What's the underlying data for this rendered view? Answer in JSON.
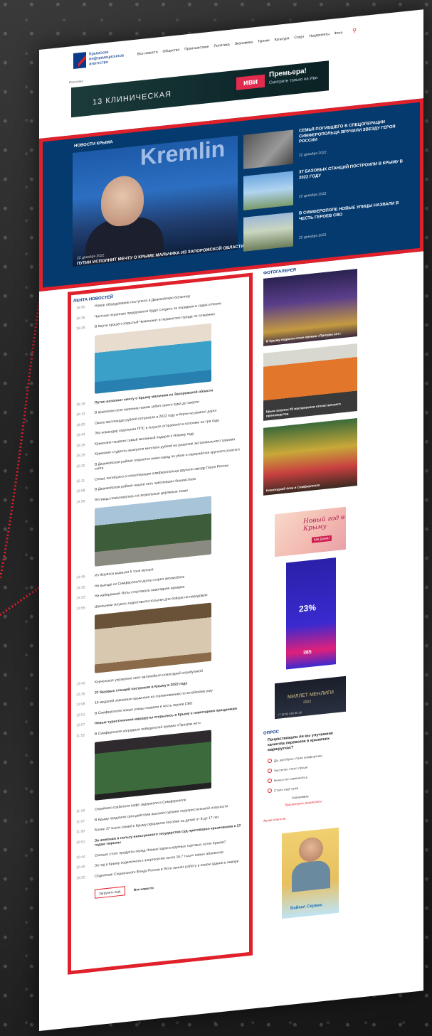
{
  "header": {
    "logo_text": "Крымское информационное агентство",
    "nav": [
      "Все новости",
      "Общество",
      "Происшествия",
      "Политика",
      "Экономика",
      "Туризм",
      "Культура",
      "Спорт",
      "Нацпроекты",
      "Фото"
    ]
  },
  "banner_top": {
    "label": "Реклама",
    "show": "13 КЛИНИЧЕСКАЯ",
    "brand": "иви",
    "title": "Премьера!",
    "subtitle": "Смотрите только на Иви"
  },
  "hero": {
    "section": "НОВОСТИ КРЫМА",
    "backdrop": "Kremlin",
    "date": "22 декабря 2022",
    "caption": "ПУТИН ИСПОЛНИТ МЕЧТУ О КРЫМЕ МАЛЬЧИКА ИЗ ЗАПОРОЖСКОЙ ОБЛАСТИ",
    "side": [
      {
        "title": "СЕМЬЯ ПОГИБШЕГО В СПЕЦОПЕРАЦИИ СИМФЕРОПОЛЬЦА ВРУЧИЛИ ЗВЕЗДУ ГЕРОЯ РОССИИ",
        "date": "22 декабря 2022"
      },
      {
        "title": "37 БАЗОВЫХ СТАНЦИЙ ПОСТРОИЛИ В КРЫМУ В 2022 ГОДУ",
        "date": "22 декабря 2022"
      },
      {
        "title": "В СИМФЕРОПОЛЕ НОВЫЕ УЛИЦЫ НАЗВАЛИ В ЧЕСТЬ ГЕРОЕВ СВО",
        "date": "22 декабря 2022"
      }
    ]
  },
  "feed": {
    "title": "ЛЕНТА НОВОСТЕЙ",
    "items1": [
      {
        "t": "16:50",
        "x": "Новое оборудование поступило в Джанкойскую больницу"
      },
      {
        "t": "16:35",
        "x": "Частные охранные предприятия будут следить за порядком в садах в Керчи"
      },
      {
        "t": "16:25",
        "x": "В Керчи прошёл открытый Чемпионат и первенство города по плаванию"
      }
    ],
    "items2": [
      {
        "t": "16:18",
        "x": "Путин исполнит мечту о Крыму мальчика из Запорожской области",
        "b": true
      },
      {
        "t": "16:13",
        "x": "В крымском селе мужчина ножом забил своего кума до смерти"
      },
      {
        "t": "16:03",
        "x": "Около миллиарда рублей потратили в 2022 году в Керчи на ремонт дорог"
      },
      {
        "t": "15:44",
        "x": "Экс-командир отделения ППС в Алуште отправился в колонию на три года"
      },
      {
        "t": "15:29",
        "x": "Крымчане назвали самый желанный подарок к Новому году"
      },
      {
        "t": "15:25",
        "x": "Крымские студенты выиграли миллион рублей на развитие экстремального туризма"
      },
      {
        "t": "15:20",
        "x": "В Джанкойском районе откроется мини-завод по убою и переработке крупного рогатого скота"
      },
      {
        "t": "15:11",
        "x": "Семье погибшего в спецоперации симферопольца вручили звезду Героя России"
      },
      {
        "t": "15:08",
        "x": "В Джанкойском районе нашли пять заболевших бешенством"
      },
      {
        "t": "14:59",
        "x": "Ялтинцы пожаловались на зеркальные дорожные знаки"
      }
    ],
    "items3": [
      {
        "t": "14:45",
        "x": "Из Форпоса вывезли 5 тонн мусора"
      },
      {
        "t": "14:32",
        "x": "На выезде из Симферополя догов сторел автомобиль"
      },
      {
        "t": "14:23",
        "x": "На набережной Ялты стартовала новогодняя ярмарка"
      },
      {
        "t": "13:59",
        "x": "Школьники Алушты подготовили посылки для бойцов на передовую"
      }
    ],
    "items4": [
      {
        "t": "13:43",
        "x": "Керченское управлене сеех автомобиля новогодней атрибутикой"
      },
      {
        "t": "13:35",
        "x": "37 базовых станций построили в Крыму в 2022 году",
        "b": true
      },
      {
        "t": "13:08",
        "x": "19 медалей завоевали крымчане на соревнованиях по китайскому ушу"
      },
      {
        "t": "12:51",
        "x": "В Симферополе новые улицы назвали в честь героев СВО"
      },
      {
        "t": "12:07",
        "x": "Новые туристические маршруты открылись в Крыму к новогодним праздникам",
        "b": true
      },
      {
        "t": "11:52",
        "x": "В Симферополе наградили победителей премии «Призрак нет»"
      }
    ],
    "items5": [
      {
        "t": "11:18",
        "x": "Серийного грабителя кафе задержали в Симферополе"
      },
      {
        "t": "11:07",
        "x": "В Крыму продлили срок действия высокого уровня террористической опасности"
      },
      {
        "t": "11:00",
        "x": "Более 37 тысяч семей в Крыму оформили пособие на детей от 8 до 17 лет"
      },
      {
        "t": "10:51",
        "x": "За шпионаж в пользу иностранного государства суд приговорил крымчанина к 13 годам тюрьмы",
        "b": true
      },
      {
        "t": "10:44",
        "x": "Сколько стоят продукты перед Новым годом в крупных торговых сетях Крыма?"
      },
      {
        "t": "10:40",
        "x": "За год в Крыму подключили к энергосетям почти 16,7 тысяч новых абонентов"
      },
      {
        "t": "10:33",
        "x": "Отделение Социального Фонда России в Ялте начнёт работу в новом здании в январе"
      }
    ],
    "load_more": "Загрузить ещё",
    "all_news": "Все новости"
  },
  "gallery": {
    "title": "ФОТОГАЛЕРЕЯ",
    "items": [
      {
        "caption": "В Крыму подвели итоги премии «Призрак нет»"
      },
      {
        "caption": "Крым закупил 25 мусоровозов отечественного производства"
      },
      {
        "caption": "Новогодний ёлка в Симферополе"
      }
    ]
  },
  "ads": {
    "ad1_text": "Новый год в Крыму",
    "ad1_sub": "как дома!",
    "ad2_big": "23%",
    "ad2_small": "385",
    "ad3_title": "МИЛЛЕТ МЕНЛИГИ",
    "ad3_year": "2022",
    "ad3_phone": "+7 (978) 348 80 28"
  },
  "poll": {
    "title": "ОПРОС",
    "question": "Почувствовали ли вы улучшение качества перевозок в крымских маршрутках?",
    "options": [
      "Да, автобусы стали комфортнее",
      "Частично стало лучше",
      "Ничего не изменилось",
      "Стало ещё хуже"
    ],
    "vote": "Голосовать",
    "results": "Просмотреть результаты",
    "archive": "Архив опросов"
  },
  "ad_bottom": {
    "brand": "Байкал Сервис"
  }
}
